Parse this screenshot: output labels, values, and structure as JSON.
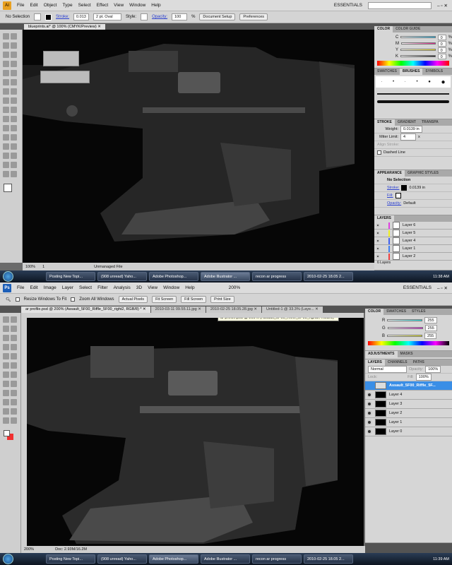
{
  "illustrator": {
    "logo": "Ai",
    "menu": [
      "File",
      "Edit",
      "Object",
      "Type",
      "Select",
      "Effect",
      "View",
      "Window",
      "Help"
    ],
    "workspace": "ESSENTIALS",
    "control": {
      "selection": "No Selection",
      "stroke_label": "Stroke:",
      "stroke_value": "0.013",
      "brush": "2 pt. Oval",
      "style_label": "Style:",
      "opacity_label": "Opacity:",
      "opacity_value": "100",
      "percent": "%",
      "document_setup": "Document Setup",
      "preferences": "Preferences"
    },
    "doc_tab": "blueprints.ai* @ 100% (CMYK/Preview)",
    "status": {
      "zoom": "100%",
      "page": "1",
      "info": "Unmanaged File"
    },
    "color_panel": {
      "tabs": [
        "COLOR",
        "COLOR GUIDE"
      ],
      "channels": [
        {
          "name": "C",
          "value": "0",
          "color": "#20b0e0"
        },
        {
          "name": "M",
          "value": "0",
          "color": "#e0208a"
        },
        {
          "name": "Y",
          "value": "0",
          "color": "#f0e020"
        },
        {
          "name": "K",
          "value": "0",
          "color": "#222222"
        }
      ],
      "unit": "%"
    },
    "brush_panel": {
      "tabs": [
        "SWATCHES",
        "BRUSHES",
        "SYMBOLS"
      ]
    },
    "stroke_panel": {
      "tabs": [
        "STROKE",
        "GRADIENT",
        "TRANSPA"
      ],
      "weight_label": "Weight:",
      "weight_value": "0.0139 in",
      "miter_label": "Miter Limit:",
      "miter_value": "4",
      "miter_unit": "x",
      "align_label": "Align Stroke:",
      "dashed_label": "Dashed Line"
    },
    "appearance_panel": {
      "tabs": [
        "APPEARANCE",
        "GRAPHIC STYLES"
      ],
      "title": "No Selection",
      "stroke_label": "Stroke:",
      "stroke_value": "0.0139 in",
      "fill_label": "Fill:",
      "opacity_label": "Opacity:",
      "opacity_value": "Default"
    },
    "layers_panel": {
      "tabs": [
        "LAYERS"
      ],
      "layers": [
        {
          "name": "Layer 6",
          "color": "#e040e0"
        },
        {
          "name": "Layer 5",
          "color": "#f0f020"
        },
        {
          "name": "Layer 4",
          "color": "#4060f0"
        },
        {
          "name": "Layer 1",
          "color": "#4080f0"
        },
        {
          "name": "Layer 2",
          "color": "#f04040"
        }
      ],
      "count": "6 Layers"
    }
  },
  "photoshop": {
    "logo": "Ps",
    "menu": [
      "File",
      "Edit",
      "Image",
      "Layer",
      "Select",
      "Filter",
      "Analysis",
      "3D",
      "View",
      "Window",
      "Help"
    ],
    "zoom_menu": "200%",
    "workspace": "ESSENTIALS",
    "options": {
      "resize": "Resize Windows To Fit",
      "zoom_all": "Zoom All Windows",
      "actual": "Actual Pixels",
      "fit": "Fit Screen",
      "fill": "Fill Screen",
      "print": "Print Size"
    },
    "tooltip": "ar profile.psd @ 200% (Assault_5F00_Riffle_5F00_right2, RGB/8) *",
    "doc_tabs": [
      "ar profile.psd @ 200% (Assault_5F00_Riffle_5F00_right2, RGB/8) *",
      "2010-03-11 09.55.11.jpg",
      "2010-02-25 18.05.28.jpg",
      "Untitled-1 @ 33.3% (Laye..."
    ],
    "status": {
      "zoom": "200%",
      "doc": "Doc: 2.93M/16.2M"
    },
    "color_panel": {
      "tabs": [
        "COLOR",
        "SWATCHES",
        "STYLES"
      ],
      "channels": [
        {
          "name": "R",
          "value": "255",
          "color": "#20e0e0"
        },
        {
          "name": "G",
          "value": "255",
          "color": "#e020e0"
        },
        {
          "name": "B",
          "value": "255",
          "color": "#e0e020"
        }
      ]
    },
    "adjust_tabs": [
      "ADJUSTMENTS",
      "MASKS"
    ],
    "layers_panel": {
      "tabs": [
        "LAYERS",
        "CHANNELS",
        "PATHS"
      ],
      "blend": "Normal",
      "opacity_label": "Opacity:",
      "opacity_value": "100%",
      "lock_label": "Lock:",
      "fill_label": "Fill:",
      "fill_value": "100%",
      "layers": [
        "Assault_5F00_Riffle_5F...",
        "Layer 4",
        "Layer 3",
        "Layer 2",
        "Layer 1",
        "Layer 0"
      ]
    }
  },
  "taskbar": {
    "tasks": [
      "Posting New Topi...",
      "(908 unread) Yaho...",
      "Adobe Photoshop...",
      "Adobe Illustrator ...",
      "recon ar progress",
      "2010-02-25 18.05 2..."
    ],
    "clock_top": "11:38 AM",
    "clock_bottom": "11:39 AM"
  }
}
